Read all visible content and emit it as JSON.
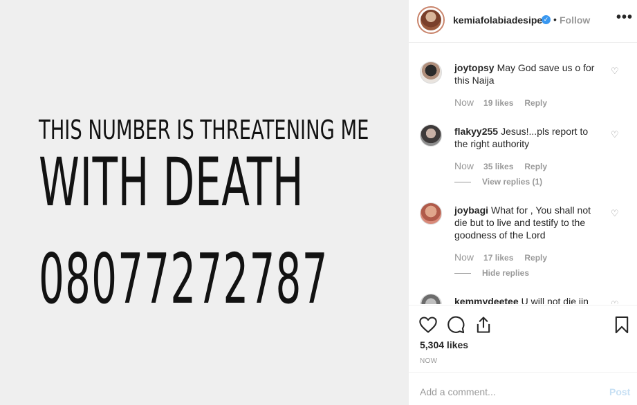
{
  "media": {
    "line1": "THIS NUMBER IS THREATENING ME",
    "line2": "WITH DEATH",
    "line3": "08077272787"
  },
  "header": {
    "username": "kemiafolabiadesipe",
    "verified_icon": "verified-badge-icon",
    "separator": "•",
    "follow_label": "Follow",
    "more_icon": "more-options-icon",
    "more_glyph": "•••"
  },
  "comments": [
    {
      "user": "joytopsy",
      "text": "May God save us o for this Naija",
      "time": "Now",
      "likes": "19 likes",
      "reply": "Reply",
      "replies_toggle": ""
    },
    {
      "user": "flakyy255",
      "text": "Jesus!...pls report to the right authority",
      "time": "Now",
      "likes": "35 likes",
      "reply": "Reply",
      "replies_toggle": "View replies (1)"
    },
    {
      "user": "joybagi",
      "text": "What for , You shall not die but to live and testify to the goodness of the Lord",
      "time": "Now",
      "likes": "17 likes",
      "reply": "Reply",
      "replies_toggle": "Hide replies"
    },
    {
      "user": "kemmydeetee",
      "text": "U will not die iin",
      "time": "",
      "likes": "",
      "reply": "",
      "replies_toggle": ""
    }
  ],
  "actions": {
    "like_icon": "heart-icon",
    "comment_icon": "comment-icon",
    "share_icon": "share-icon",
    "save_icon": "bookmark-icon",
    "likes_count": "5,304 likes",
    "timestamp": "NOW"
  },
  "add_comment": {
    "placeholder": "Add a comment...",
    "post_label": "Post"
  },
  "colors": {
    "media_bg": "#efefef",
    "muted_text": "#999999",
    "verified": "#3897f0",
    "post_disabled": "#c7e0f4"
  }
}
